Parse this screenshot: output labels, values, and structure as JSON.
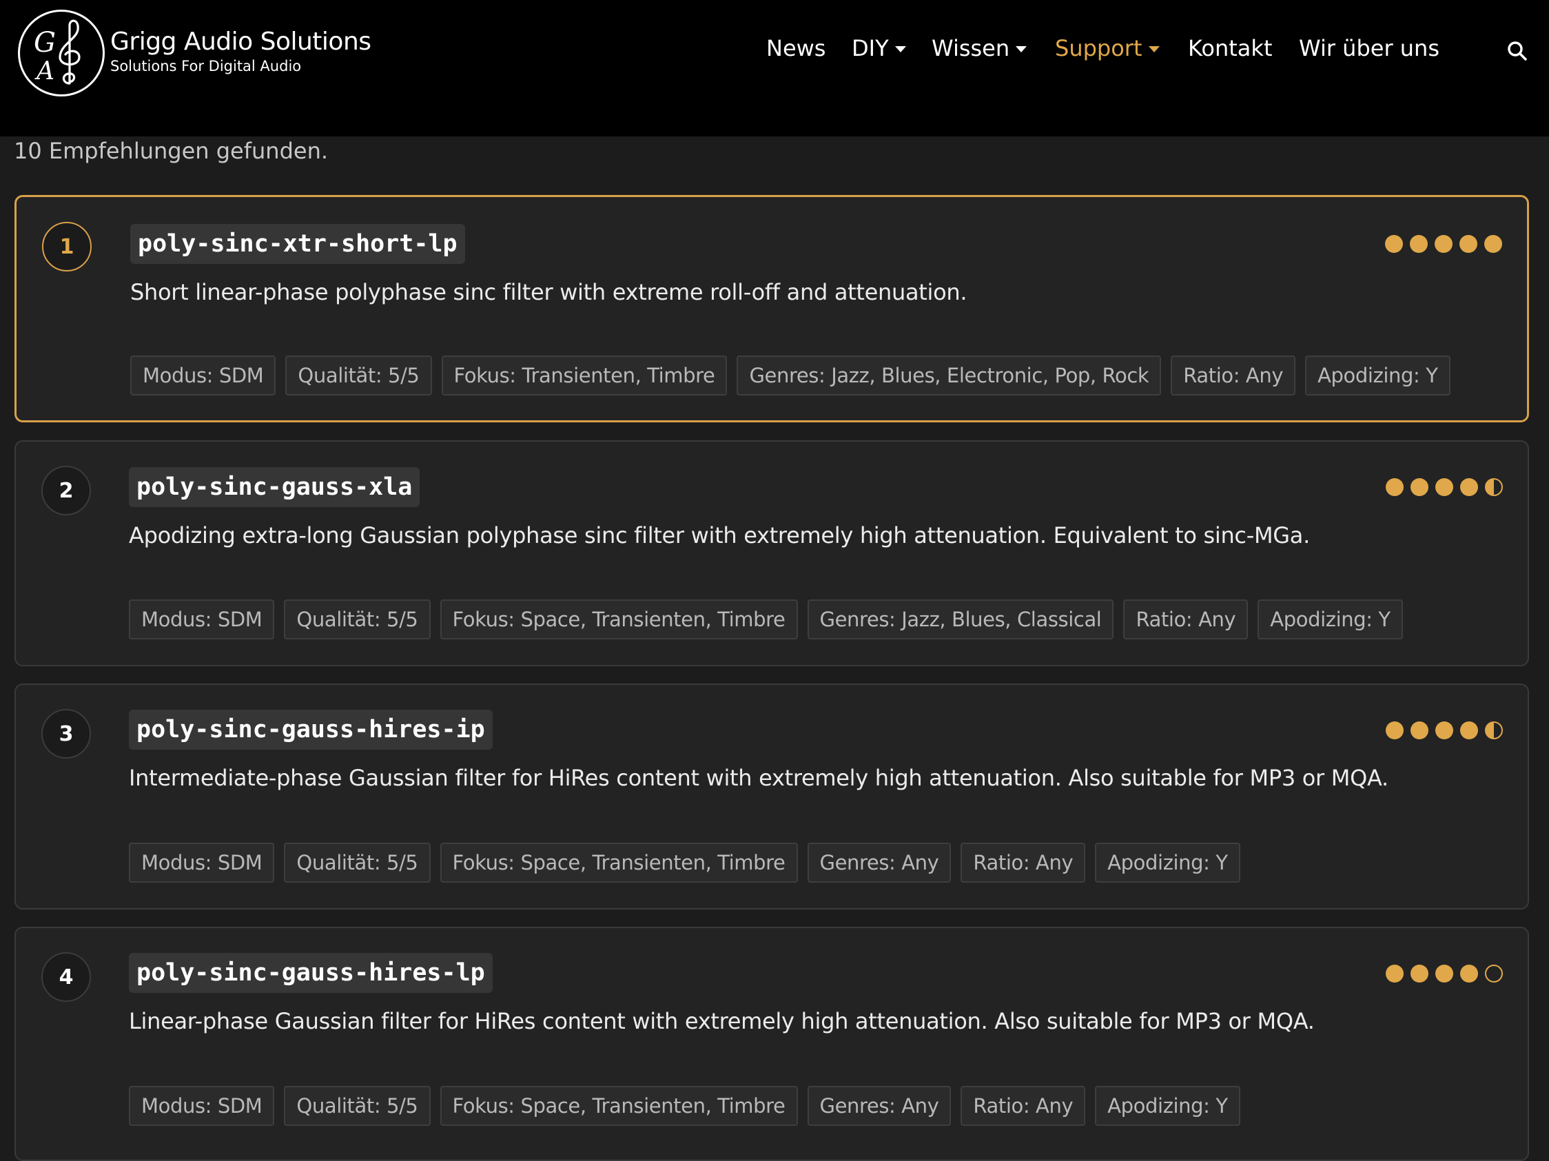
{
  "brand": {
    "name": "Grigg Audio Solutions",
    "tagline": "Solutions For Digital Audio",
    "monogram": "GA"
  },
  "nav": {
    "items": [
      {
        "label": "News",
        "dropdown": false,
        "active": false
      },
      {
        "label": "DIY",
        "dropdown": true,
        "active": false
      },
      {
        "label": "Wissen",
        "dropdown": true,
        "active": false
      },
      {
        "label": "Support",
        "dropdown": true,
        "active": true
      },
      {
        "label": "Kontakt",
        "dropdown": false,
        "active": false
      },
      {
        "label": "Wir über uns",
        "dropdown": false,
        "active": false
      }
    ],
    "search_icon": "search-icon"
  },
  "results": {
    "count_text": "10 Empfehlungen gefunden."
  },
  "colors": {
    "accent": "#e0a84a",
    "background": "#1c1c1c",
    "card": "#232323",
    "header": "#000000"
  },
  "cards": [
    {
      "rank": "1",
      "name": "poly-sinc-xtr-short-lp",
      "description": "Short linear-phase polyphase sinc filter with extreme roll-off and attenuation.",
      "rating": 5,
      "tags": [
        "Modus: SDM",
        "Qualität: 5/5",
        "Fokus: Transienten, Timbre",
        "Genres: Jazz, Blues, Electronic, Pop, Rock",
        "Ratio: Any",
        "Apodizing: Y"
      ]
    },
    {
      "rank": "2",
      "name": "poly-sinc-gauss-xla",
      "description": "Apodizing extra-long Gaussian polyphase sinc filter with extremely high attenuation. Equivalent to sinc-MGa.",
      "rating": 4.5,
      "tags": [
        "Modus: SDM",
        "Qualität: 5/5",
        "Fokus: Space, Transienten, Timbre",
        "Genres: Jazz, Blues, Classical",
        "Ratio: Any",
        "Apodizing: Y"
      ]
    },
    {
      "rank": "3",
      "name": "poly-sinc-gauss-hires-ip",
      "description": "Intermediate-phase Gaussian filter for HiRes content with extremely high attenuation. Also suitable for MP3 or MQA.",
      "rating": 4.5,
      "tags": [
        "Modus: SDM",
        "Qualität: 5/5",
        "Fokus: Space, Transienten, Timbre",
        "Genres: Any",
        "Ratio: Any",
        "Apodizing: Y"
      ]
    },
    {
      "rank": "4",
      "name": "poly-sinc-gauss-hires-lp",
      "description": "Linear-phase Gaussian filter for HiRes content with extremely high attenuation. Also suitable for MP3 or MQA.",
      "rating": 4,
      "tags": [
        "Modus: SDM",
        "Qualität: 5/5",
        "Fokus: Space, Transienten, Timbre",
        "Genres: Any",
        "Ratio: Any",
        "Apodizing: Y"
      ]
    }
  ]
}
